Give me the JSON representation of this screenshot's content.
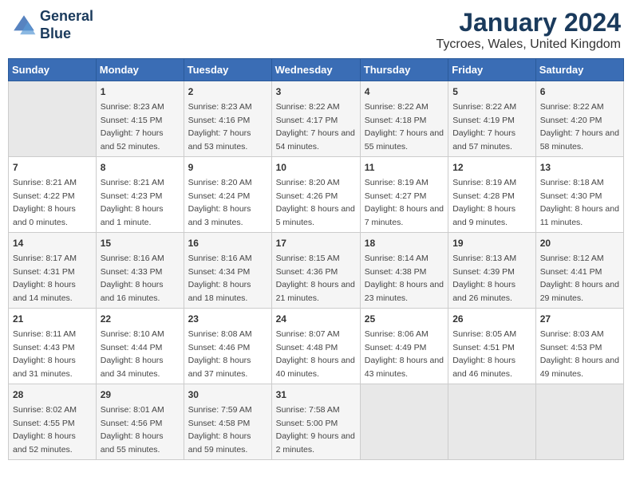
{
  "header": {
    "logo_line1": "General",
    "logo_line2": "Blue",
    "month": "January 2024",
    "location": "Tycroes, Wales, United Kingdom"
  },
  "days_of_week": [
    "Sunday",
    "Monday",
    "Tuesday",
    "Wednesday",
    "Thursday",
    "Friday",
    "Saturday"
  ],
  "weeks": [
    [
      {
        "day": "",
        "empty": true
      },
      {
        "day": "1",
        "sunrise": "Sunrise: 8:23 AM",
        "sunset": "Sunset: 4:15 PM",
        "daylight": "Daylight: 7 hours and 52 minutes."
      },
      {
        "day": "2",
        "sunrise": "Sunrise: 8:23 AM",
        "sunset": "Sunset: 4:16 PM",
        "daylight": "Daylight: 7 hours and 53 minutes."
      },
      {
        "day": "3",
        "sunrise": "Sunrise: 8:22 AM",
        "sunset": "Sunset: 4:17 PM",
        "daylight": "Daylight: 7 hours and 54 minutes."
      },
      {
        "day": "4",
        "sunrise": "Sunrise: 8:22 AM",
        "sunset": "Sunset: 4:18 PM",
        "daylight": "Daylight: 7 hours and 55 minutes."
      },
      {
        "day": "5",
        "sunrise": "Sunrise: 8:22 AM",
        "sunset": "Sunset: 4:19 PM",
        "daylight": "Daylight: 7 hours and 57 minutes."
      },
      {
        "day": "6",
        "sunrise": "Sunrise: 8:22 AM",
        "sunset": "Sunset: 4:20 PM",
        "daylight": "Daylight: 7 hours and 58 minutes."
      }
    ],
    [
      {
        "day": "7",
        "sunrise": "Sunrise: 8:21 AM",
        "sunset": "Sunset: 4:22 PM",
        "daylight": "Daylight: 8 hours and 0 minutes."
      },
      {
        "day": "8",
        "sunrise": "Sunrise: 8:21 AM",
        "sunset": "Sunset: 4:23 PM",
        "daylight": "Daylight: 8 hours and 1 minute."
      },
      {
        "day": "9",
        "sunrise": "Sunrise: 8:20 AM",
        "sunset": "Sunset: 4:24 PM",
        "daylight": "Daylight: 8 hours and 3 minutes."
      },
      {
        "day": "10",
        "sunrise": "Sunrise: 8:20 AM",
        "sunset": "Sunset: 4:26 PM",
        "daylight": "Daylight: 8 hours and 5 minutes."
      },
      {
        "day": "11",
        "sunrise": "Sunrise: 8:19 AM",
        "sunset": "Sunset: 4:27 PM",
        "daylight": "Daylight: 8 hours and 7 minutes."
      },
      {
        "day": "12",
        "sunrise": "Sunrise: 8:19 AM",
        "sunset": "Sunset: 4:28 PM",
        "daylight": "Daylight: 8 hours and 9 minutes."
      },
      {
        "day": "13",
        "sunrise": "Sunrise: 8:18 AM",
        "sunset": "Sunset: 4:30 PM",
        "daylight": "Daylight: 8 hours and 11 minutes."
      }
    ],
    [
      {
        "day": "14",
        "sunrise": "Sunrise: 8:17 AM",
        "sunset": "Sunset: 4:31 PM",
        "daylight": "Daylight: 8 hours and 14 minutes."
      },
      {
        "day": "15",
        "sunrise": "Sunrise: 8:16 AM",
        "sunset": "Sunset: 4:33 PM",
        "daylight": "Daylight: 8 hours and 16 minutes."
      },
      {
        "day": "16",
        "sunrise": "Sunrise: 8:16 AM",
        "sunset": "Sunset: 4:34 PM",
        "daylight": "Daylight: 8 hours and 18 minutes."
      },
      {
        "day": "17",
        "sunrise": "Sunrise: 8:15 AM",
        "sunset": "Sunset: 4:36 PM",
        "daylight": "Daylight: 8 hours and 21 minutes."
      },
      {
        "day": "18",
        "sunrise": "Sunrise: 8:14 AM",
        "sunset": "Sunset: 4:38 PM",
        "daylight": "Daylight: 8 hours and 23 minutes."
      },
      {
        "day": "19",
        "sunrise": "Sunrise: 8:13 AM",
        "sunset": "Sunset: 4:39 PM",
        "daylight": "Daylight: 8 hours and 26 minutes."
      },
      {
        "day": "20",
        "sunrise": "Sunrise: 8:12 AM",
        "sunset": "Sunset: 4:41 PM",
        "daylight": "Daylight: 8 hours and 29 minutes."
      }
    ],
    [
      {
        "day": "21",
        "sunrise": "Sunrise: 8:11 AM",
        "sunset": "Sunset: 4:43 PM",
        "daylight": "Daylight: 8 hours and 31 minutes."
      },
      {
        "day": "22",
        "sunrise": "Sunrise: 8:10 AM",
        "sunset": "Sunset: 4:44 PM",
        "daylight": "Daylight: 8 hours and 34 minutes."
      },
      {
        "day": "23",
        "sunrise": "Sunrise: 8:08 AM",
        "sunset": "Sunset: 4:46 PM",
        "daylight": "Daylight: 8 hours and 37 minutes."
      },
      {
        "day": "24",
        "sunrise": "Sunrise: 8:07 AM",
        "sunset": "Sunset: 4:48 PM",
        "daylight": "Daylight: 8 hours and 40 minutes."
      },
      {
        "day": "25",
        "sunrise": "Sunrise: 8:06 AM",
        "sunset": "Sunset: 4:49 PM",
        "daylight": "Daylight: 8 hours and 43 minutes."
      },
      {
        "day": "26",
        "sunrise": "Sunrise: 8:05 AM",
        "sunset": "Sunset: 4:51 PM",
        "daylight": "Daylight: 8 hours and 46 minutes."
      },
      {
        "day": "27",
        "sunrise": "Sunrise: 8:03 AM",
        "sunset": "Sunset: 4:53 PM",
        "daylight": "Daylight: 8 hours and 49 minutes."
      }
    ],
    [
      {
        "day": "28",
        "sunrise": "Sunrise: 8:02 AM",
        "sunset": "Sunset: 4:55 PM",
        "daylight": "Daylight: 8 hours and 52 minutes."
      },
      {
        "day": "29",
        "sunrise": "Sunrise: 8:01 AM",
        "sunset": "Sunset: 4:56 PM",
        "daylight": "Daylight: 8 hours and 55 minutes."
      },
      {
        "day": "30",
        "sunrise": "Sunrise: 7:59 AM",
        "sunset": "Sunset: 4:58 PM",
        "daylight": "Daylight: 8 hours and 59 minutes."
      },
      {
        "day": "31",
        "sunrise": "Sunrise: 7:58 AM",
        "sunset": "Sunset: 5:00 PM",
        "daylight": "Daylight: 9 hours and 2 minutes."
      },
      {
        "day": "",
        "empty": true
      },
      {
        "day": "",
        "empty": true
      },
      {
        "day": "",
        "empty": true
      }
    ]
  ]
}
